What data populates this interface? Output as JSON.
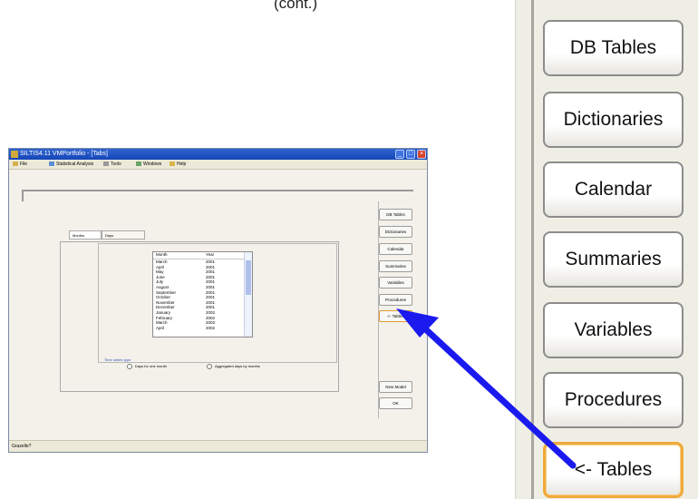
{
  "caption": "(cont.)",
  "window": {
    "title": "SILTIS4.11 VMPortfolio - [Tabs]",
    "menus": [
      "File",
      "Statistical Analysis",
      "Tools",
      "Windows",
      "Help"
    ]
  },
  "tabs": [
    "Months",
    "Days"
  ],
  "table": {
    "headers": [
      "Month",
      "Year"
    ],
    "rows": [
      [
        "March",
        "2001"
      ],
      [
        "April",
        "2001"
      ],
      [
        "May",
        "2001"
      ],
      [
        "June",
        "2001"
      ],
      [
        "July",
        "2001"
      ],
      [
        "August",
        "2001"
      ],
      [
        "September",
        "2001"
      ],
      [
        "October",
        "2001"
      ],
      [
        "November",
        "2001"
      ],
      [
        "December",
        "2001"
      ],
      [
        "January",
        "2002"
      ],
      [
        "February",
        "2002"
      ],
      [
        "March",
        "2002"
      ],
      [
        "April",
        "2002"
      ]
    ]
  },
  "time_series_type": {
    "label": "Time series type",
    "options": [
      "Days for one month",
      "Aggregated days by months"
    ]
  },
  "side_buttons": [
    "DB Tables",
    "Dictionaries",
    "Calendar",
    "Summaries",
    "Variables",
    "Procedures",
    "<- Tables"
  ],
  "bottom_buttons": [
    "New Model",
    "OK"
  ],
  "status_text": "Grazelle?",
  "zoom_buttons": [
    "DB Tables",
    "Dictionaries",
    "Calendar",
    "Summaries",
    "Variables",
    "Procedures",
    "<- Tables"
  ],
  "colors": {
    "arrow": "#1a1aef",
    "highlight": "#efaa3a",
    "titlebar": "#1d4fc4"
  }
}
